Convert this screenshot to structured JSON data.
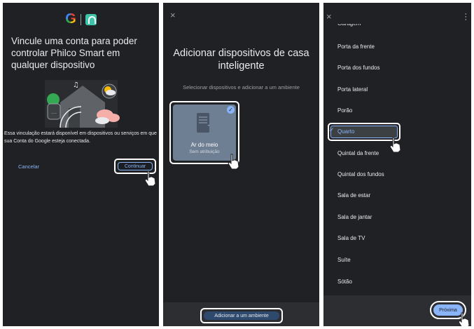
{
  "screen1": {
    "title": "Vincule uma conta para poder controlar Philco Smart em qualquer dispositivo",
    "note": "Essa vinculação estará disponível em dispositivos ou serviços em que sua Conta do Google esteja conectada.",
    "cancel_label": "Cancelar",
    "continue_label": "Continuar"
  },
  "screen2": {
    "close": "×",
    "title": "Adicionar dispositivos de casa inteligente",
    "subtitle": "Selecionar dispositivos e adicionar a um ambiente",
    "device": {
      "name": "Ar do meio",
      "room": "Sem atribuição",
      "check": "✓"
    },
    "add_button_label": "Adicionar a um ambiente"
  },
  "screen3": {
    "close": "×",
    "rooms": [
      "Garagem",
      "Porta da frente",
      "Porta dos fundos",
      "Porta lateral",
      "Porão",
      "Quarto",
      "Quintal da frente",
      "Quintal dos fundos",
      "Sala de estar",
      "Sala de jantar",
      "Sala de TV",
      "Suíte",
      "Sótão"
    ],
    "selected_room": "Quarto",
    "check": "✓",
    "next_label": "Próxima"
  },
  "colors": {
    "background": "#202124",
    "accent": "#8ab4f8",
    "text": "#e8eaed"
  }
}
